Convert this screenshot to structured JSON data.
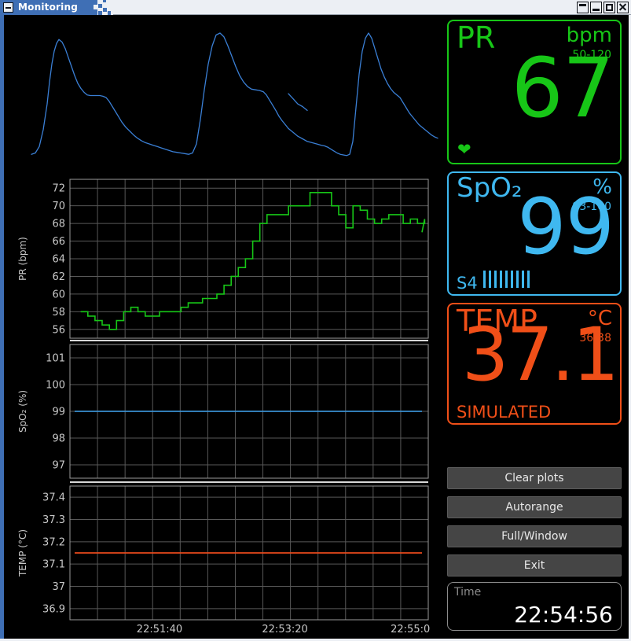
{
  "window": {
    "title": "Monitoring",
    "buttons": [
      {
        "name": "shade-button",
        "glyph": "shade"
      },
      {
        "name": "minimize-button",
        "glyph": "minimize"
      },
      {
        "name": "maximize-button",
        "glyph": "maximize"
      },
      {
        "name": "close-button",
        "glyph": "close"
      }
    ]
  },
  "vitals": {
    "pr": {
      "label": "PR",
      "unit": "bpm",
      "range": "50-120",
      "value": "67",
      "icon": "heart-icon",
      "color": "#17c617"
    },
    "spo2": {
      "label": "SpO₂",
      "unit": "%",
      "range": "93-100",
      "value": "99",
      "signal_label": "S4",
      "signal_bars": 9,
      "color": "#3fb8f0"
    },
    "temp": {
      "label": "TEMP",
      "unit": "°C",
      "range": "36-38",
      "value": "37.1",
      "status": "SIMULATED",
      "color": "#f04f18"
    }
  },
  "controls": {
    "buttons": [
      {
        "label": "Clear plots",
        "name": "clear-plots-button"
      },
      {
        "label": "Autorange",
        "name": "autorange-button"
      },
      {
        "label": "Full/Window",
        "name": "full-window-button"
      },
      {
        "label": "Exit",
        "name": "exit-button"
      }
    ]
  },
  "time_panel": {
    "label": "Time",
    "value": "22:54:56"
  },
  "chart_data": [
    {
      "type": "line",
      "name": "pleth-waveform",
      "title": "",
      "xlabel": "",
      "ylabel": "",
      "grid": false,
      "color": "#3a7fd5",
      "ylim": [
        0,
        1
      ],
      "xlim": [
        0,
        556
      ],
      "comment": "photoplethysmograph pulse waveform, 4 beats with dicrotic notch, sweep gap near x=365",
      "segments": [
        {
          "x": [
            35,
            40,
            45,
            50,
            55,
            58,
            61,
            64,
            67,
            70,
            74,
            78,
            82,
            86,
            90,
            94,
            98,
            102,
            106,
            110,
            114,
            118,
            122,
            126,
            130,
            134,
            138,
            142,
            146,
            150,
            155,
            160,
            165,
            170,
            175,
            180,
            185,
            190,
            195,
            200,
            205,
            210,
            215,
            220,
            225,
            230,
            235,
            240,
            245,
            250,
            255,
            260,
            265,
            270,
            275,
            280,
            285,
            290,
            295,
            300,
            305,
            310,
            315,
            320,
            325,
            330,
            334,
            338,
            342,
            346,
            350,
            354,
            358,
            362
          ],
          "y": [
            0.06,
            0.07,
            0.12,
            0.25,
            0.45,
            0.62,
            0.76,
            0.86,
            0.92,
            0.95,
            0.93,
            0.88,
            0.81,
            0.74,
            0.67,
            0.61,
            0.57,
            0.54,
            0.52,
            0.515,
            0.515,
            0.515,
            0.515,
            0.51,
            0.5,
            0.47,
            0.43,
            0.39,
            0.35,
            0.31,
            0.27,
            0.24,
            0.21,
            0.185,
            0.165,
            0.15,
            0.14,
            0.13,
            0.12,
            0.11,
            0.1,
            0.09,
            0.08,
            0.075,
            0.07,
            0.065,
            0.06,
            0.07,
            0.14,
            0.33,
            0.56,
            0.76,
            0.9,
            0.985,
            1.0,
            0.97,
            0.9,
            0.82,
            0.74,
            0.67,
            0.62,
            0.585,
            0.565,
            0.56,
            0.555,
            0.545,
            0.52,
            0.48,
            0.44,
            0.4,
            0.355,
            0.32,
            0.29,
            0.26
          ]
        },
        {
          "x": [
            362,
            368,
            374,
            380,
            386,
            392,
            398,
            404,
            408,
            412,
            416,
            420,
            424,
            428,
            432,
            436,
            440,
            444,
            448,
            452,
            456,
            460,
            464,
            468,
            472,
            476,
            480,
            484,
            488,
            492,
            496,
            500,
            504,
            508,
            512,
            516,
            520,
            524,
            528,
            532,
            536,
            540,
            544,
            548,
            552
          ],
          "y": [
            0.26,
            0.23,
            0.2,
            0.18,
            0.16,
            0.15,
            0.14,
            0.13,
            0.125,
            0.115,
            0.1,
            0.085,
            0.07,
            0.06,
            0.055,
            0.05,
            0.06,
            0.16,
            0.42,
            0.68,
            0.86,
            0.96,
            1.0,
            0.96,
            0.88,
            0.8,
            0.72,
            0.66,
            0.61,
            0.57,
            0.54,
            0.52,
            0.5,
            0.46,
            0.42,
            0.38,
            0.35,
            0.32,
            0.29,
            0.27,
            0.25,
            0.23,
            0.21,
            0.195,
            0.185
          ]
        },
        {
          "x": [
            362,
            368,
            374,
            380,
            386
          ],
          "y": [
            0.53,
            0.49,
            0.45,
            0.43,
            0.4
          ]
        }
      ]
    },
    {
      "type": "line",
      "name": "pr-trend",
      "ylabel": "PR (bpm)",
      "xlabel": "",
      "grid": true,
      "color": "#17c617",
      "ylim": [
        55,
        73
      ],
      "yticks": [
        56,
        58,
        60,
        62,
        64,
        66,
        68,
        70,
        72
      ],
      "drawstyle": "steps-post",
      "x": [
        0.03,
        0.05,
        0.07,
        0.09,
        0.11,
        0.13,
        0.15,
        0.17,
        0.19,
        0.21,
        0.23,
        0.25,
        0.27,
        0.29,
        0.31,
        0.33,
        0.35,
        0.37,
        0.39,
        0.41,
        0.43,
        0.45,
        0.47,
        0.49,
        0.51,
        0.53,
        0.55,
        0.57,
        0.59,
        0.61,
        0.63,
        0.65,
        0.67,
        0.69,
        0.71,
        0.73,
        0.75,
        0.77,
        0.79,
        0.81,
        0.83,
        0.85,
        0.87,
        0.89,
        0.91,
        0.93,
        0.95,
        0.97,
        0.99
      ],
      "values": [
        58,
        57.5,
        57,
        56.5,
        56,
        57,
        58,
        58.5,
        58,
        57.5,
        57.5,
        58,
        58,
        58,
        58.5,
        59,
        59,
        59.5,
        59.5,
        60,
        61,
        62,
        63,
        64,
        66,
        68,
        69,
        69,
        69,
        70,
        70,
        70,
        71.5,
        71.5,
        71.5,
        70,
        69,
        67.5,
        70,
        69.5,
        68.5,
        68,
        68.5,
        69,
        69,
        68,
        68.5,
        68,
        68.5
      ],
      "last_value": 67
    },
    {
      "type": "line",
      "name": "spo2-trend",
      "ylabel": "SpO₂ (%)",
      "xlabel": "",
      "grid": true,
      "color": "#3a8fd0",
      "ylim": [
        96.5,
        101.5
      ],
      "yticks": [
        97,
        98,
        99,
        100,
        101
      ],
      "constant_value": 99
    },
    {
      "type": "line",
      "name": "temp-trend",
      "ylabel": "TEMP (°C)",
      "xlabel": "",
      "grid": true,
      "color": "#e8491c",
      "ylim": [
        36.85,
        37.45
      ],
      "yticks": [
        "36.9",
        "37",
        "37.1",
        "37.2",
        "37.3",
        "37.4"
      ],
      "constant_value": 37.15
    }
  ],
  "time_axis": {
    "ticks": [
      "22:51:40",
      "22:53:20",
      "22:55:0"
    ],
    "tick_positions": [
      0.25,
      0.6,
      0.95
    ]
  }
}
